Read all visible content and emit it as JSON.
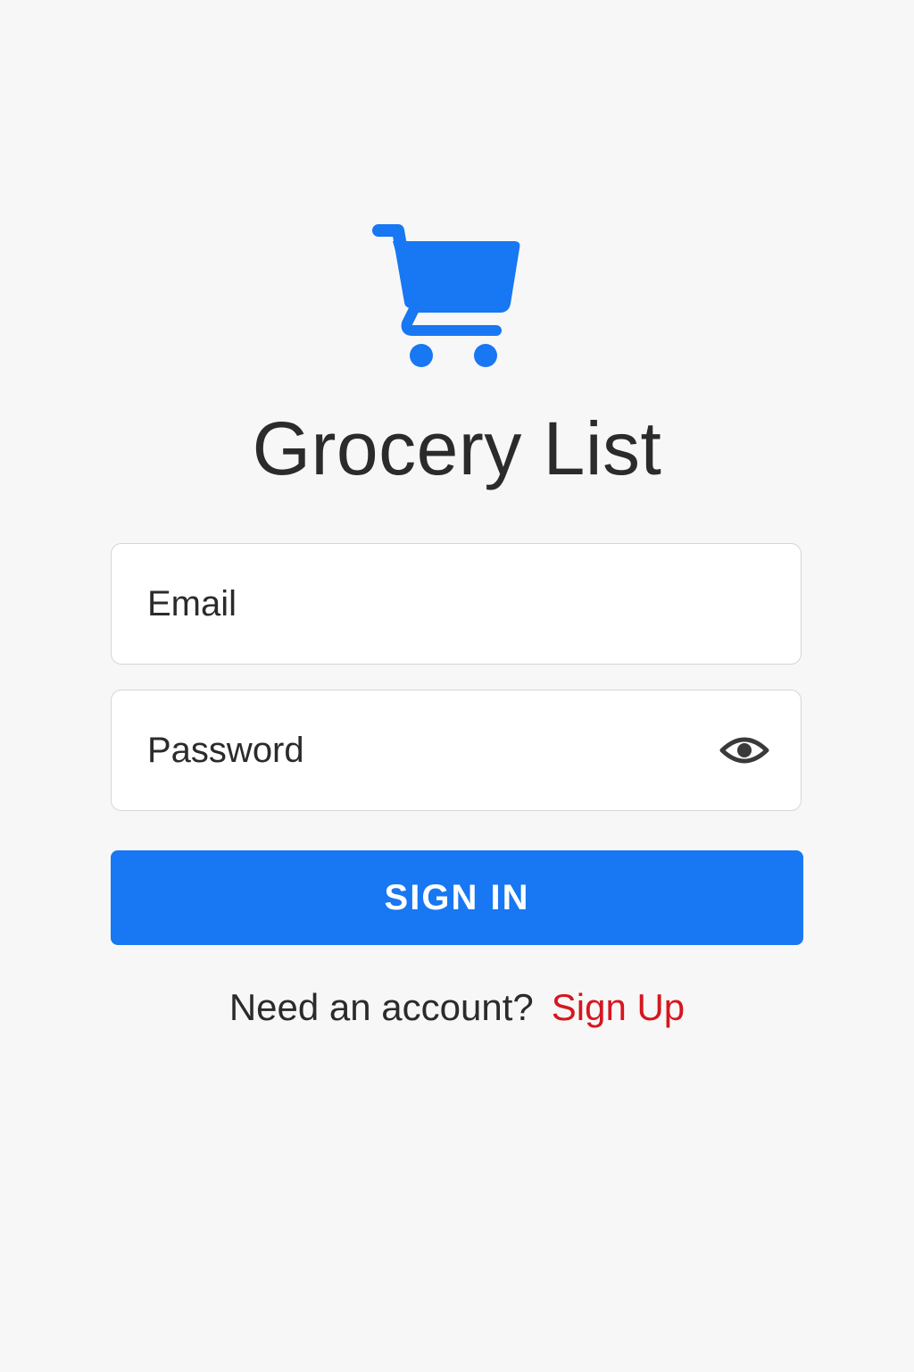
{
  "app": {
    "title": "Grocery List",
    "logo_icon": "shopping-cart-icon"
  },
  "form": {
    "email_placeholder": "Email",
    "password_placeholder": "Password",
    "password_toggle_icon": "eye-icon",
    "submit_label": "SIGN IN"
  },
  "footer": {
    "prompt": "Need an account?",
    "link_label": "Sign Up"
  },
  "colors": {
    "background": "#f7f7f7",
    "accent": "#1877f2",
    "link": "#d7151f",
    "text": "#2b2b2b",
    "field_border": "#d6d6d6"
  }
}
